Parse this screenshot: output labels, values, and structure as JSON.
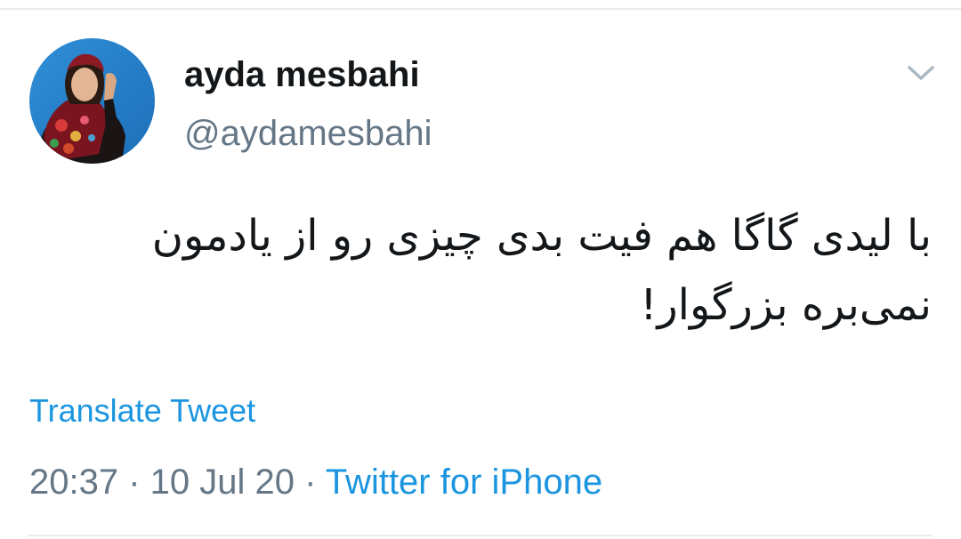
{
  "tweet": {
    "author": {
      "display_name": "ayda mesbahi",
      "handle": "@aydamesbahi",
      "avatar_icon": "profile-photo"
    },
    "menu_icon": "chevron-down-icon",
    "text": "با لیدی گاگا هم فیت بدی چیزی رو از یادمون نمی‌بره بزرگوار!",
    "translate_label": "Translate Tweet",
    "time": "20:37",
    "separator": " · ",
    "date": "10 Jul 20",
    "source": "Twitter for iPhone"
  },
  "colors": {
    "link": "#1b95e0",
    "secondary_text": "#657786",
    "primary_text": "#14171a",
    "divider": "#e6ecf0"
  }
}
